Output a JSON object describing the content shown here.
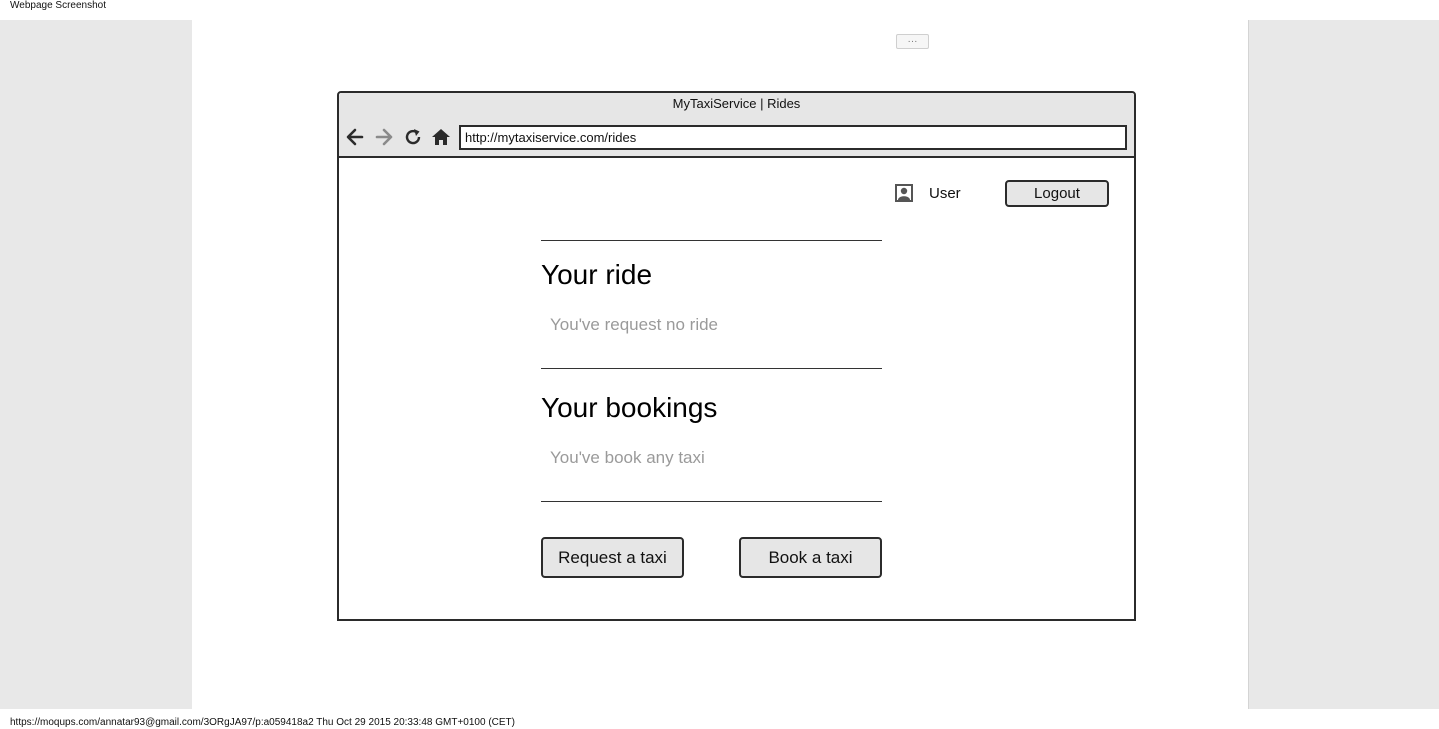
{
  "page": {
    "header_label": "Webpage Screenshot",
    "footer_text": "https://moqups.com/annatar93@gmail.com/3ORgJA97/p:a059418a2 Thu Oct 29 2015 20:33:48 GMT+0100 (CET)",
    "more_handle": "···"
  },
  "browser": {
    "title": "MyTaxiService | Rides",
    "url": "http://mytaxiservice.com/rides",
    "nav_icons": [
      "back-arrow-icon",
      "forward-arrow-icon",
      "reload-icon",
      "home-icon"
    ]
  },
  "header": {
    "user_label": "User",
    "logout_label": "Logout"
  },
  "ride_section": {
    "title": "Your ride",
    "placeholder": "You've request no ride"
  },
  "bookings_section": {
    "title": "Your bookings",
    "placeholder": "You've book any taxi"
  },
  "actions": {
    "request_label": "Request a taxi",
    "book_label": "Book a taxi"
  },
  "colors": {
    "background": "#e8e8e8",
    "canvas": "#ffffff",
    "chrome": "#e6e6e6",
    "stroke": "#2b2b2b",
    "placeholder_text": "#9a9a9a"
  }
}
